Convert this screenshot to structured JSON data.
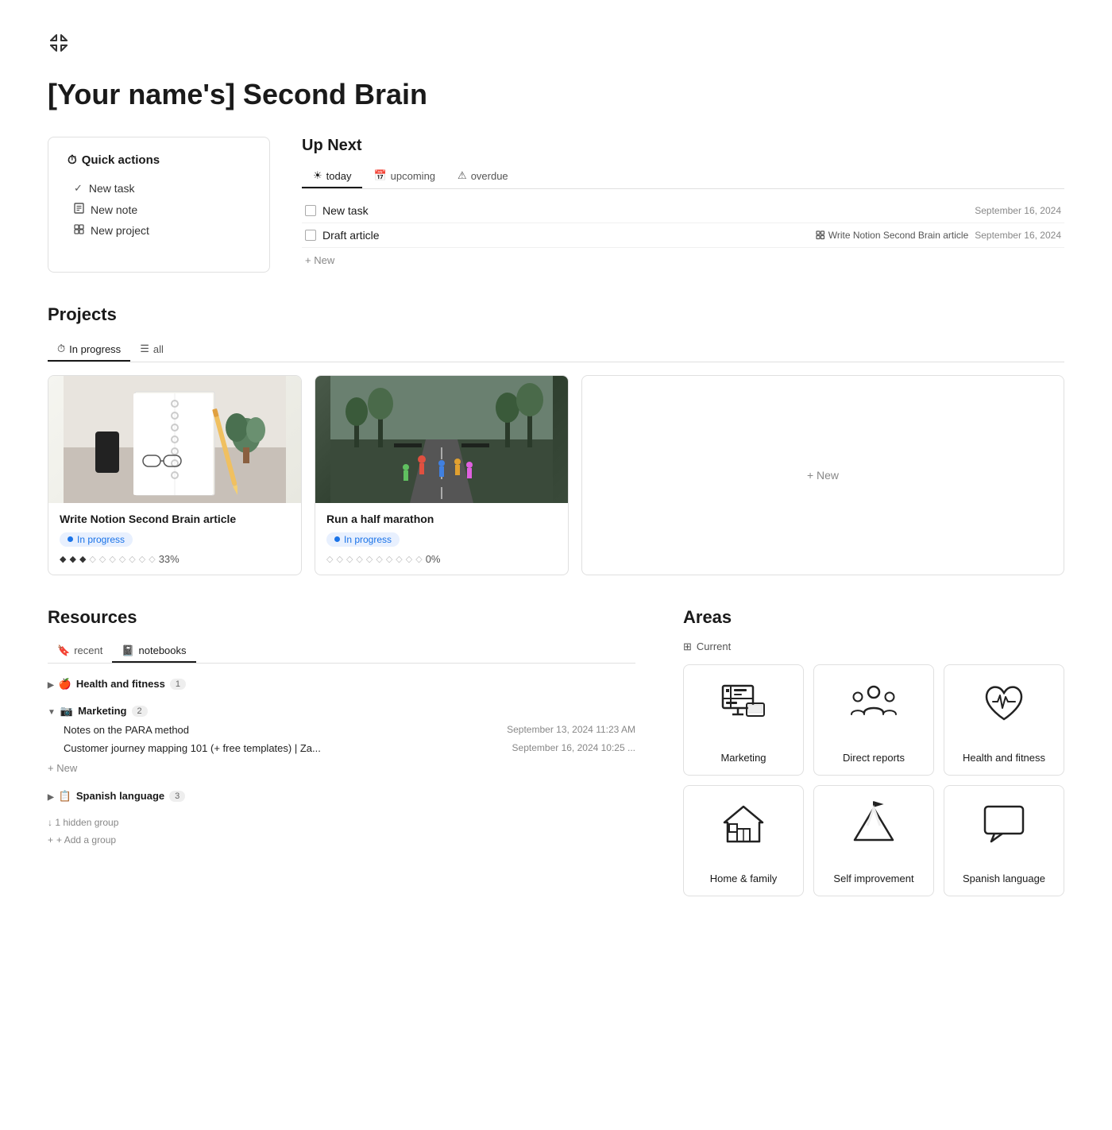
{
  "header": {
    "compress_icon": "⤡",
    "title": "[Your name's] Second Brain"
  },
  "quick_actions": {
    "title": "Quick actions",
    "icon": "⏱",
    "items": [
      {
        "label": "New task",
        "icon": "✓"
      },
      {
        "label": "New note",
        "icon": "📄"
      },
      {
        "label": "New project",
        "icon": "☰"
      }
    ]
  },
  "up_next": {
    "title": "Up Next",
    "tabs": [
      {
        "label": "today",
        "icon": "☀",
        "active": true
      },
      {
        "label": "upcoming",
        "icon": "📅",
        "active": false
      },
      {
        "label": "overdue",
        "icon": "⚠",
        "active": false
      }
    ],
    "tasks": [
      {
        "label": "New task",
        "date": "September 16, 2024",
        "project": ""
      },
      {
        "label": "Draft article",
        "date": "September 16, 2024",
        "project": "Write Notion Second Brain article"
      }
    ],
    "add_label": "+ New"
  },
  "projects": {
    "title": "Projects",
    "tabs": [
      {
        "label": "In progress",
        "icon": "⏱",
        "active": true
      },
      {
        "label": "all",
        "icon": "☰",
        "active": false
      }
    ],
    "cards": [
      {
        "name": "Write Notion Second Brain article",
        "status": "In progress",
        "progress_filled": 3,
        "progress_total": 10,
        "progress_pct": "33%"
      },
      {
        "name": "Run a half marathon",
        "status": "In progress",
        "progress_filled": 0,
        "progress_total": 10,
        "progress_pct": "0%"
      }
    ],
    "new_label": "+ New"
  },
  "resources": {
    "title": "Resources",
    "tabs": [
      {
        "label": "recent",
        "icon": "🔖",
        "active": false
      },
      {
        "label": "notebooks",
        "icon": "📓",
        "active": true
      }
    ],
    "groups": [
      {
        "name": "Health and fitness",
        "icon": "🍎",
        "count": 1,
        "expanded": false,
        "items": []
      },
      {
        "name": "Marketing",
        "icon": "📷",
        "count": 2,
        "expanded": true,
        "items": [
          {
            "label": "Notes on the PARA method",
            "date": "September 13, 2024 11:23 AM"
          },
          {
            "label": "Customer journey mapping 101 (+ free templates) | Za...",
            "date": "September 16, 2024 10:25 ..."
          }
        ]
      },
      {
        "name": "Spanish language",
        "icon": "📋",
        "count": 3,
        "expanded": false,
        "items": []
      }
    ],
    "hidden_group_label": "↓ 1 hidden group",
    "add_group_label": "+ Add a group"
  },
  "areas": {
    "title": "Areas",
    "filter_label": "Current",
    "filter_icon": "⊞",
    "cards": [
      {
        "label": "Marketing",
        "icon_type": "marketing"
      },
      {
        "label": "Direct reports",
        "icon_type": "people"
      },
      {
        "label": "Health and fitness",
        "icon_type": "health"
      },
      {
        "label": "Home & family",
        "icon_type": "home"
      },
      {
        "label": "Self improvement",
        "icon_type": "mountain"
      },
      {
        "label": "Spanish language",
        "icon_type": "chat"
      }
    ]
  }
}
